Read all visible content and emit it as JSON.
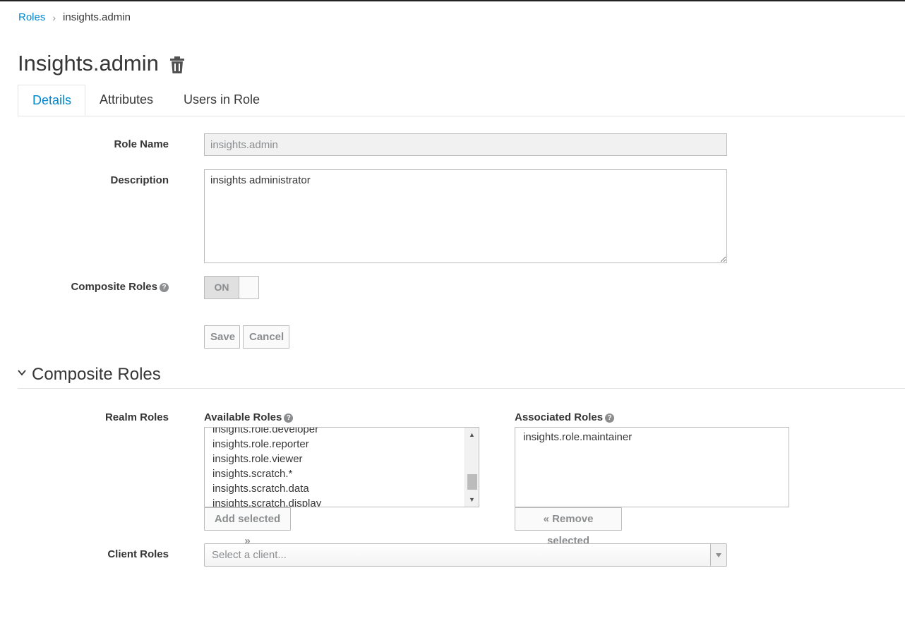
{
  "breadcrumb": {
    "parent": "Roles",
    "separator": "›",
    "current": "insights.admin"
  },
  "page": {
    "title": "Insights.admin"
  },
  "tabs": [
    {
      "label": "Details",
      "active": true
    },
    {
      "label": "Attributes",
      "active": false
    },
    {
      "label": "Users in Role",
      "active": false
    }
  ],
  "form": {
    "role_name_label": "Role Name",
    "role_name_value": "insights.admin",
    "description_label": "Description",
    "description_value": "insights administrator",
    "composite_label": "Composite Roles",
    "composite_state": "ON",
    "save_label": "Save",
    "cancel_label": "Cancel"
  },
  "composite_section": {
    "title": "Composite Roles",
    "realm_roles_label": "Realm Roles",
    "available_label": "Available Roles",
    "available_items": [
      "insights.role.developer",
      "insights.role.reporter",
      "insights.role.viewer",
      "insights.scratch.*",
      "insights.scratch.data",
      "insights.scratch.display"
    ],
    "add_selected_label": "Add selected »",
    "associated_label": "Associated Roles",
    "associated_items": [
      "insights.role.maintainer"
    ],
    "remove_selected_label": "« Remove selected",
    "client_roles_label": "Client Roles",
    "client_select_placeholder": "Select a client..."
  },
  "colors": {
    "link": "#0088ce",
    "text": "#363636",
    "muted": "#8b8d8f",
    "border": "#bbbbbb"
  }
}
